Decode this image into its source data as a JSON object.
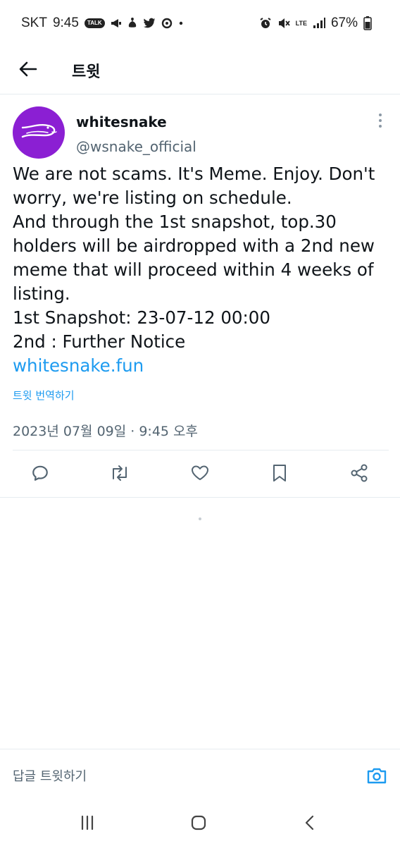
{
  "status_bar": {
    "carrier": "SKT",
    "time": "9:45",
    "talk_badge": "TALK",
    "network": "LTE",
    "battery": "67%",
    "icons_left": [
      "kakaotalk-icon",
      "megaphone-icon",
      "app-icon",
      "twitter-icon",
      "app-icon",
      "dot-icon"
    ],
    "icons_right": [
      "alarm-icon",
      "mute-icon",
      "lte-icon",
      "signal-icon",
      "battery-icon"
    ]
  },
  "header": {
    "title": "트윗",
    "back_icon": "arrow-left-icon"
  },
  "tweet": {
    "display_name": "whitesnake",
    "handle": "@wsnake_official",
    "body_lines": [
      "We are not scams. It's Meme. Enjoy. Don't",
      "worry, we're listing on schedule.",
      "And through the 1st snapshot, top.30",
      "holders will be airdropped with a 2nd new",
      "meme that will proceed within 4 weeks of",
      "listing.",
      "1st Snapshot: 23-07-12 00:00",
      "2nd : Further Notice"
    ],
    "link": "whitesnake.fun",
    "translate_label": "트윗 번역하기",
    "timestamp": "2023년 07월 09일 · 9:45 오후",
    "colors": {
      "avatar_bg": "#8b1fd3",
      "link": "#1d9bf0",
      "secondary_text": "#536471"
    }
  },
  "actions": [
    {
      "name": "reply",
      "icon": "comment-icon"
    },
    {
      "name": "retweet",
      "icon": "retweet-icon"
    },
    {
      "name": "like",
      "icon": "heart-icon"
    },
    {
      "name": "bookmark",
      "icon": "bookmark-icon"
    },
    {
      "name": "share",
      "icon": "share-icon"
    }
  ],
  "reply_bar": {
    "placeholder": "답글 트윗하기",
    "camera_icon": "camera-icon"
  },
  "nav_bar": {
    "icons": [
      "recent-apps-icon",
      "home-icon",
      "back-icon"
    ]
  }
}
